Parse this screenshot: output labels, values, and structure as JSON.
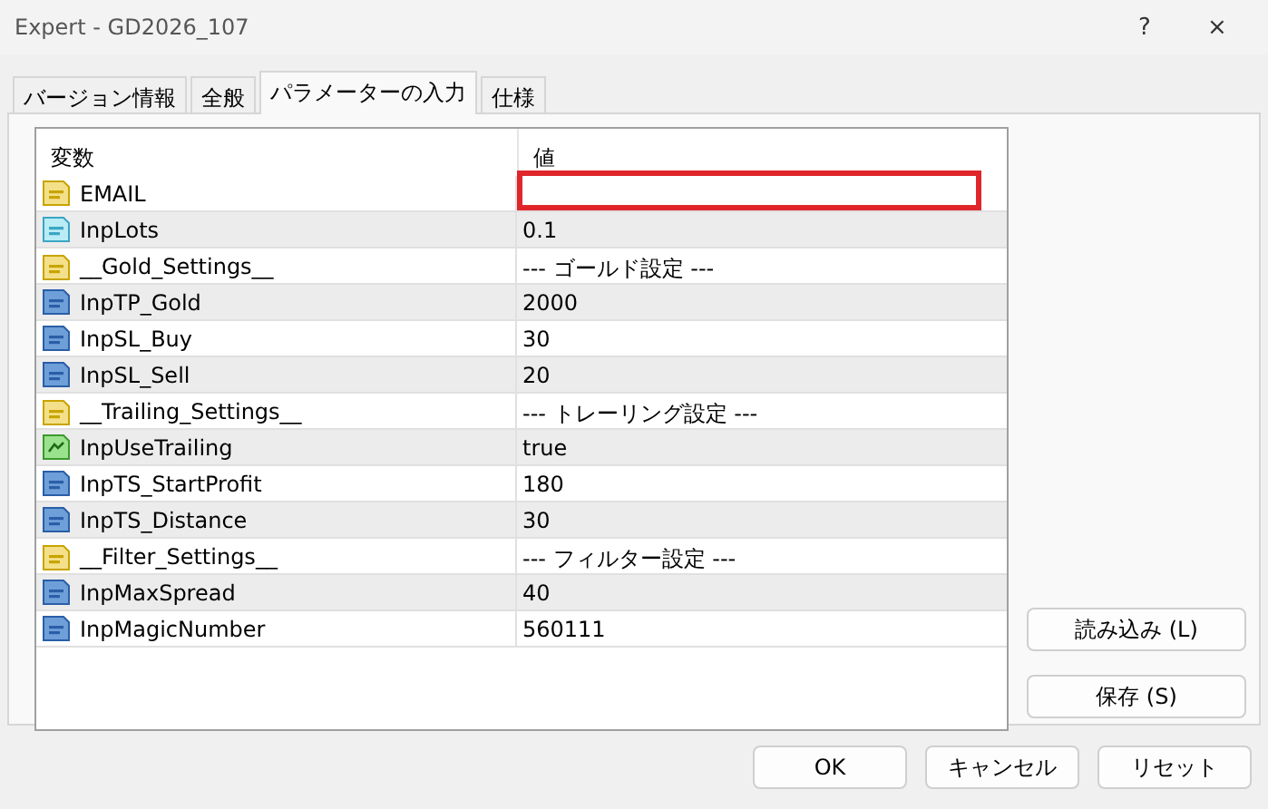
{
  "window": {
    "title": "Expert - GD2026_107",
    "help": "?",
    "close": "×"
  },
  "tabs": [
    {
      "label": "バージョン情報",
      "selected": false
    },
    {
      "label": "全般",
      "selected": false
    },
    {
      "label": "パラメーターの入力",
      "selected": true
    },
    {
      "label": "仕様",
      "selected": false
    }
  ],
  "table": {
    "columns": [
      "変数",
      "値"
    ],
    "rows": [
      {
        "kind": "string",
        "name": "EMAIL",
        "value": "",
        "highlighted": true
      },
      {
        "kind": "double",
        "name": "InpLots",
        "value": "0.1",
        "highlighted": false
      },
      {
        "kind": "string",
        "name": "__Gold_Settings__",
        "value": "--- ゴールド設定 ---",
        "highlighted": false
      },
      {
        "kind": "int",
        "name": "InpTP_Gold",
        "value": "2000",
        "highlighted": false
      },
      {
        "kind": "int",
        "name": "InpSL_Buy",
        "value": "30",
        "highlighted": false
      },
      {
        "kind": "int",
        "name": "InpSL_Sell",
        "value": "20",
        "highlighted": false
      },
      {
        "kind": "string",
        "name": "__Trailing_Settings__",
        "value": "--- トレーリング設定 ---",
        "highlighted": false
      },
      {
        "kind": "bool",
        "name": "InpUseTrailing",
        "value": "true",
        "highlighted": false
      },
      {
        "kind": "int",
        "name": "InpTS_StartProfit",
        "value": "180",
        "highlighted": false
      },
      {
        "kind": "int",
        "name": "InpTS_Distance",
        "value": "30",
        "highlighted": false
      },
      {
        "kind": "string",
        "name": "__Filter_Settings__",
        "value": "--- フィルター設定 ---",
        "highlighted": false
      },
      {
        "kind": "int",
        "name": "InpMaxSpread",
        "value": "40",
        "highlighted": false
      },
      {
        "kind": "int",
        "name": "InpMagicNumber",
        "value": "560111",
        "highlighted": false
      }
    ]
  },
  "side_buttons": [
    "読み込み (L)",
    "保存 (S)"
  ],
  "buttons": [
    "OK",
    "キャンセル",
    "リセット"
  ]
}
